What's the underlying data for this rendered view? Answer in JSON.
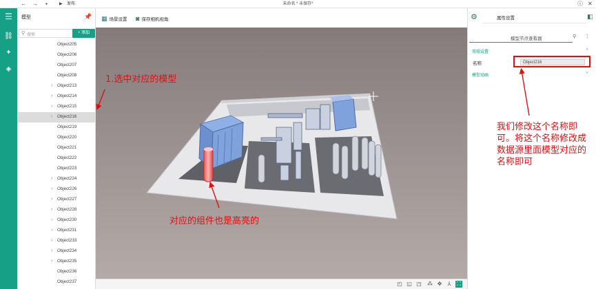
{
  "titlebar": {
    "publish_label": "发布",
    "title": "未命名 * 未保存*",
    "help_icon": "help-circle-icon",
    "close_icon": "close-icon"
  },
  "colors": {
    "accent": "#16a085",
    "annotation": "#e01010",
    "viewport_bg": "#9a8e8e"
  },
  "model_panel": {
    "title": "模型",
    "search_placeholder": "搜索",
    "add_label": "+ 添加",
    "items": [
      {
        "label": "Object205",
        "expandable": false,
        "selected": false
      },
      {
        "label": "Object206",
        "expandable": false,
        "selected": false
      },
      {
        "label": "Object207",
        "expandable": false,
        "selected": false
      },
      {
        "label": "Object208",
        "expandable": false,
        "selected": false
      },
      {
        "label": "Object213",
        "expandable": true,
        "selected": false
      },
      {
        "label": "Object214",
        "expandable": true,
        "selected": false
      },
      {
        "label": "Object215",
        "expandable": true,
        "selected": false
      },
      {
        "label": "Object216",
        "expandable": true,
        "selected": true
      },
      {
        "label": "Object219",
        "expandable": false,
        "selected": false
      },
      {
        "label": "Object220",
        "expandable": false,
        "selected": false
      },
      {
        "label": "Object221",
        "expandable": false,
        "selected": false
      },
      {
        "label": "Object222",
        "expandable": false,
        "selected": false
      },
      {
        "label": "Object223",
        "expandable": false,
        "selected": false
      },
      {
        "label": "Object224",
        "expandable": true,
        "selected": false
      },
      {
        "label": "Object226",
        "expandable": true,
        "selected": false
      },
      {
        "label": "Object227",
        "expandable": true,
        "selected": false
      },
      {
        "label": "Object228",
        "expandable": true,
        "selected": false
      },
      {
        "label": "Object230",
        "expandable": true,
        "selected": false
      },
      {
        "label": "Object231",
        "expandable": true,
        "selected": false
      },
      {
        "label": "Object233",
        "expandable": true,
        "selected": false
      },
      {
        "label": "Object234",
        "expandable": true,
        "selected": false
      },
      {
        "label": "Object235",
        "expandable": true,
        "selected": false
      },
      {
        "label": "Object236",
        "expandable": false,
        "selected": false
      },
      {
        "label": "Object237",
        "expandable": false,
        "selected": false
      }
    ]
  },
  "viewport_toolbar": {
    "scene_settings": "场景设置",
    "save_camera": "保存相机视角"
  },
  "right_panel": {
    "tab": "属性设置",
    "subheader": "模型节点查看器",
    "group_general": "常规设置",
    "name_label": "名称",
    "name_value": "Object216",
    "group_animation": "模型动画"
  },
  "annotations": {
    "select_model": "1.选中对应的模型",
    "highlight": "对应的组件也是高亮的",
    "instruction": "我们修改这个名称即可。将这个名称修改成数据源里面模型对应的名称即可"
  }
}
